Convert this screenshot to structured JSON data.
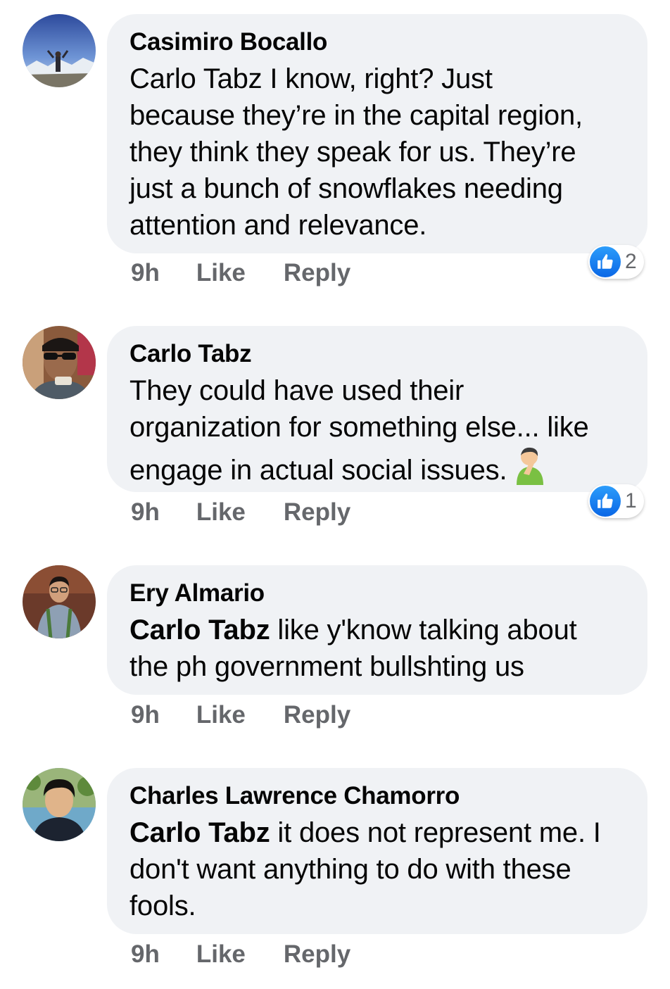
{
  "comments": [
    {
      "author": "Casimiro Bocallo",
      "mention": "",
      "text": "Carlo Tabz I know, right?  Just\nbecause they’re in the capital region,\nthey think they speak for us.  They’re\njust a bunch of snowflakes needing\nattention and relevance.",
      "time": "9h",
      "like_label": "Like",
      "reply_label": "Reply",
      "reaction_count": "2"
    },
    {
      "author": "Carlo Tabz",
      "mention": "",
      "text": "They could have used their\norganization for something else... like\nengage in actual social issues.",
      "emoji": "man-facepalming-icon",
      "time": "9h",
      "like_label": "Like",
      "reply_label": "Reply",
      "reaction_count": "1"
    },
    {
      "author": "Ery Almario",
      "mention": "Carlo Tabz",
      "text": " like y'know talking about\nthe ph government bullshting us",
      "time": "9h",
      "like_label": "Like",
      "reply_label": "Reply"
    },
    {
      "author": "Charles Lawrence Chamorro",
      "mention": "Carlo Tabz",
      "text": " it does not represent me. I\ndon't want anything to do with these\nfools.",
      "time": "9h",
      "like_label": "Like",
      "reply_label": "Reply"
    }
  ],
  "colors": {
    "bubble": "#f0f2f5",
    "meta_text": "#65676b",
    "like_blue": "#1877f2"
  }
}
